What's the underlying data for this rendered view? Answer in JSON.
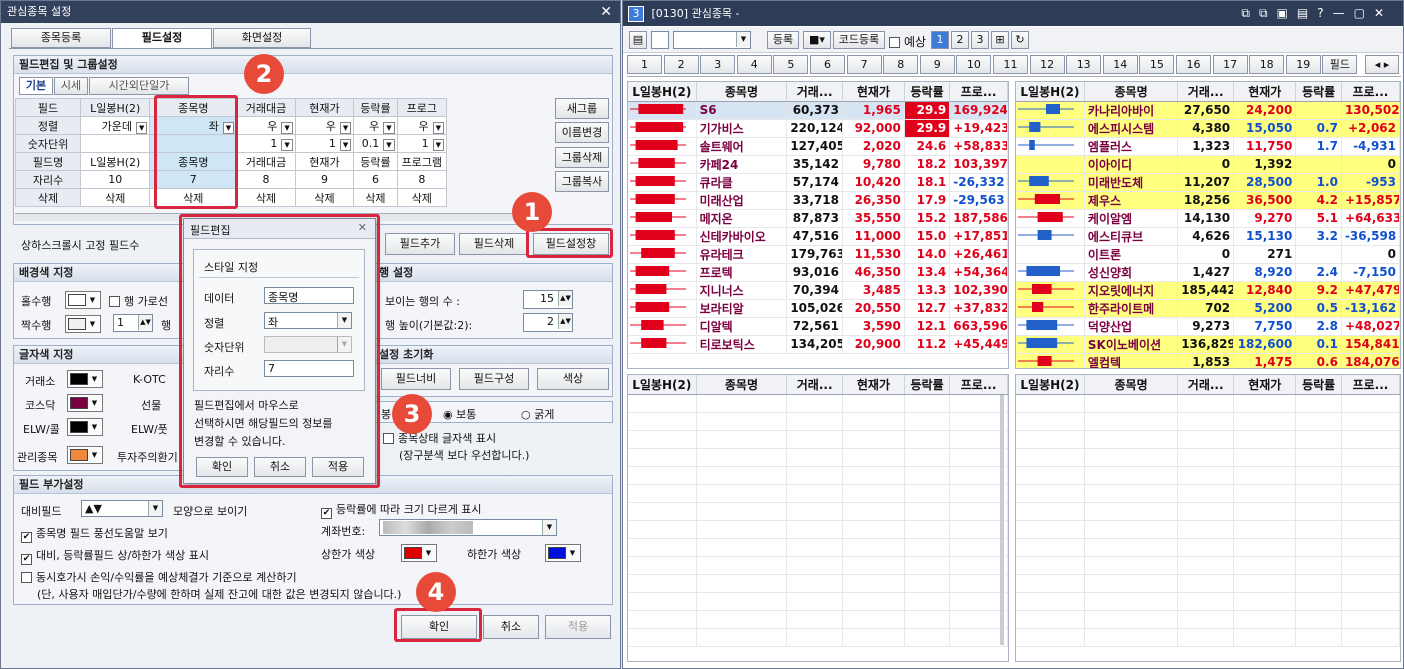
{
  "left_window": {
    "title": "관심종목 설정",
    "tabs": [
      "종목등록",
      "필드설정",
      "화면설정"
    ],
    "section_title": "필드편집 및 그룹설정",
    "subtabs": [
      "기본",
      "시세",
      "시간외단일가"
    ],
    "field_rows": {
      "labels": [
        "필드",
        "정렬",
        "숫자단위",
        "필드명",
        "자리수",
        "삭제"
      ],
      "cols": [
        {
          "field": "L일봉H(2)",
          "align": "가운데",
          "unit": "",
          "name": "L일봉H(2)",
          "digits": "10",
          "del": "삭제"
        },
        {
          "field": "종목명",
          "align": "좌",
          "unit": "",
          "name": "종목명",
          "digits": "7",
          "del": "삭제"
        },
        {
          "field": "거래대금",
          "align": "우",
          "unit": "1",
          "name": "거래대금",
          "digits": "8",
          "del": "삭제"
        },
        {
          "field": "현재가",
          "align": "우",
          "unit": "1",
          "name": "현재가",
          "digits": "9",
          "del": "삭제"
        },
        {
          "field": "등락률",
          "align": "우",
          "unit": "0.1",
          "name": "등락률",
          "digits": "6",
          "del": "삭제"
        },
        {
          "field": "프로그",
          "align": "우",
          "unit": "1",
          "name": "프로그램",
          "digits": "8",
          "del": "삭제"
        }
      ]
    },
    "side_buttons": [
      "새그룹",
      "이름변경",
      "그룹삭제",
      "그룹복사"
    ],
    "fixed_label": "상하스크롤시 고정 필드수",
    "field_buttons": [
      "필드추가",
      "필드삭제",
      "필드설정창"
    ],
    "bg_section": {
      "title": "배경색 지정",
      "odd": "홀수행",
      "even": "짝수행",
      "row_line": "행 가로선",
      "row_label": "행",
      "stepper": "1"
    },
    "row_section": {
      "title": "행 설정",
      "visible_rows": "보이는 행의 수 :",
      "visible_val": "15",
      "row_height": "행 높이(기본값:2):",
      "height_val": "2"
    },
    "font_section": {
      "title": "글자색 지정",
      "items": [
        "거래소",
        "코스닥",
        "ELW/콜",
        "관리종목"
      ],
      "items2": [
        "K-OTC",
        "선물",
        "ELW/풋",
        "투자주의환기"
      ]
    },
    "init_section": {
      "title": "설정 초기화",
      "buttons": [
        "필드너비",
        "필드구성",
        "색상"
      ]
    },
    "font_style": {
      "title": "봉",
      "normal": "보통",
      "bold": "굵게"
    },
    "status_color": {
      "label": "종목상태 글자색 표시",
      "note": "(장구분색 보다 우선합니다.)"
    },
    "extra_section": {
      "title": "필드 부가설정",
      "contrast_label": "대비필드",
      "contrast_value": "▲▼",
      "shape_label": "모양으로 보이기",
      "size_label": "등락률에 따라 크기 다르게 표시",
      "tooltip_label": "종목명 필드 풍선도움말 보기",
      "account_label": "계좌번호:",
      "limit_label": "대비, 등락률필드 상/하한가 색상 표시",
      "upper_label": "상한가 색상",
      "lower_label": "하한가 색상",
      "simul_label": "동시호가시 손익/수익률을 예상체결가 기준으로 계산하기",
      "simul_note": "(단, 사용자 매입단가/수량에 한하며 실제 잔고에 대한 값은 변경되지 않습니다.)"
    },
    "bottom_buttons": [
      "확인",
      "취소",
      "적용"
    ]
  },
  "popup": {
    "title": "필드편집",
    "group": "스타일 지정",
    "data_label": "데이터",
    "data_value": "종목명",
    "align_label": "정렬",
    "align_value": "좌",
    "unit_label": "숫자단위",
    "digits_label": "자리수",
    "digits_value": "7",
    "help": [
      "필드편집에서 마우스로",
      "선택하시면 해당필드의 정보를",
      "변경할 수 있습니다."
    ],
    "buttons": [
      "확인",
      "취소",
      "적용"
    ]
  },
  "badges": [
    "1",
    "2",
    "3",
    "4"
  ],
  "right_window": {
    "title": "[0130] 관심종목 -",
    "num_icon": "3",
    "toolbar": {
      "register": "등록",
      "code_register": "코드등록",
      "expect": "예상",
      "pages": [
        "1",
        "2",
        "3"
      ]
    },
    "tabs": [
      "1",
      "2",
      "3",
      "4",
      "5",
      "6",
      "7",
      "8",
      "9",
      "10",
      "11",
      "12",
      "13",
      "14",
      "15",
      "16",
      "17",
      "18",
      "19",
      "필드"
    ],
    "headers": [
      "L일봉H(2)",
      "종목명",
      "거래...",
      "현재가",
      "등락률",
      "프로..."
    ],
    "left_rows": [
      {
        "name": "S6",
        "vol": "60,373",
        "price": "1,965",
        "rate": "29.9",
        "prog": "169,924",
        "hl": true,
        "sel": true,
        "candle": "r:0.15:0.95"
      },
      {
        "name": "기가비스",
        "vol": "220,124",
        "price": "92,000",
        "rate": "29.9",
        "prog": "+19,423",
        "hl": true,
        "candle": "r:0.1:0.95"
      },
      {
        "name": "솔트웨어",
        "vol": "127,405",
        "price": "2,020",
        "rate": "24.6",
        "prog": "+58,833",
        "candle": "r:0.1:0.85"
      },
      {
        "name": "카페24",
        "vol": "35,142",
        "price": "9,780",
        "rate": "18.2",
        "prog": "103,397",
        "candle": "r:0.15:0.8"
      },
      {
        "name": "큐라클",
        "vol": "57,174",
        "price": "10,420",
        "rate": "18.1",
        "prog": "-26,332",
        "candle": "r:0.1:0.8"
      },
      {
        "name": "미래산업",
        "vol": "33,718",
        "price": "26,350",
        "rate": "17.9",
        "prog": "-29,563",
        "candle": "r:0.1:0.8"
      },
      {
        "name": "메지온",
        "vol": "87,873",
        "price": "35,550",
        "rate": "15.2",
        "prog": "187,586",
        "candle": "r:0.1:0.75"
      },
      {
        "name": "신테카바이오",
        "vol": "47,516",
        "price": "11,000",
        "rate": "15.0",
        "prog": "+17,851",
        "candle": "r:0.1:0.8"
      },
      {
        "name": "유라테크",
        "vol": "179,763",
        "price": "11,530",
        "rate": "14.0",
        "prog": "+26,461",
        "candle": "r:0.2:0.8"
      },
      {
        "name": "프로텍",
        "vol": "93,016",
        "price": "46,350",
        "rate": "13.4",
        "prog": "+54,364",
        "candle": "r:0.1:0.7"
      },
      {
        "name": "지니너스",
        "vol": "70,394",
        "price": "3,485",
        "rate": "13.3",
        "prog": "102,390",
        "candle": "r:0.1:0.65"
      },
      {
        "name": "보라티알",
        "vol": "105,026",
        "price": "20,550",
        "rate": "12.7",
        "prog": "+37,832",
        "candle": "r:0.1:0.7"
      },
      {
        "name": "디알텍",
        "vol": "72,561",
        "price": "3,590",
        "rate": "12.1",
        "prog": "663,596",
        "candle": "r:0.2:0.6"
      },
      {
        "name": "티로보틱스",
        "vol": "134,205",
        "price": "20,900",
        "rate": "11.2",
        "prog": "+45,449",
        "candle": "r:0.2:0.65"
      }
    ],
    "right_rows": [
      {
        "name": "카나리아바이",
        "vol": "27,650",
        "price": "24,200",
        "rate": "",
        "prog": "130,502",
        "hl": true,
        "candle": "b:0.5:0.75",
        "pc": "up",
        "rc": ""
      },
      {
        "name": "에스피시스템",
        "vol": "4,380",
        "price": "15,050",
        "rate": "0.7",
        "prog": "+2,062",
        "hl": true,
        "candle": "b:0.2:0.4",
        "pc": "dn",
        "rc": "dn"
      },
      {
        "name": "엠플러스",
        "vol": "1,323",
        "price": "11,750",
        "rate": "1.7",
        "prog": "-4,931",
        "candle": "b:0.2:0.3",
        "pc": "up",
        "rc": "dn"
      },
      {
        "name": "이아이디",
        "vol": "0",
        "price": "1,392",
        "rate": "",
        "prog": "0",
        "hl": true,
        "candle": "",
        "pc": "",
        "rc": ""
      },
      {
        "name": "미래반도체",
        "vol": "11,207",
        "price": "28,500",
        "rate": "1.0",
        "prog": "-953",
        "hl": true,
        "candle": "b:0.2:0.55",
        "pc": "dn",
        "rc": "dn"
      },
      {
        "name": "제우스",
        "vol": "18,256",
        "price": "36,500",
        "rate": "4.2",
        "prog": "+15,857",
        "hl": true,
        "candle": "r:0.3:0.75",
        "pc": "up",
        "rc": "up"
      },
      {
        "name": "케이알엠",
        "vol": "14,130",
        "price": "9,270",
        "rate": "5.1",
        "prog": "+64,633",
        "candle": "r:0.35:0.8",
        "pc": "up",
        "rc": "up"
      },
      {
        "name": "에스티큐브",
        "vol": "4,626",
        "price": "15,130",
        "rate": "3.2",
        "prog": "-36,598",
        "candle": "b:0.35:0.6",
        "pc": "dn",
        "rc": "dn"
      },
      {
        "name": "이트론",
        "vol": "0",
        "price": "271",
        "rate": "",
        "prog": "0",
        "candle": "",
        "pc": "",
        "rc": ""
      },
      {
        "name": "성신양회",
        "vol": "1,427",
        "price": "8,920",
        "rate": "2.4",
        "prog": "-7,150",
        "candle": "b:0.15:0.75",
        "pc": "dn",
        "rc": "dn"
      },
      {
        "name": "지오릿에너지",
        "vol": "185,442",
        "price": "12,840",
        "rate": "9.2",
        "prog": "+47,479",
        "hl": true,
        "candle": "r:0.25:0.6",
        "pc": "up",
        "rc": "up"
      },
      {
        "name": "한주라이트메",
        "vol": "702",
        "price": "5,200",
        "rate": "0.5",
        "prog": "-13,162",
        "hl": true,
        "candle": "r:0.25:0.45",
        "pc": "dn",
        "rc": "dn"
      },
      {
        "name": "덕양산업",
        "vol": "9,273",
        "price": "7,750",
        "rate": "2.8",
        "prog": "+48,027",
        "candle": "b:0.15:0.7",
        "pc": "dn",
        "rc": "dn"
      },
      {
        "name": "SK이노베이션",
        "vol": "136,829",
        "price": "182,600",
        "rate": "0.1",
        "prog": "154,841",
        "hl": true,
        "candle": "b:0.15:0.7",
        "pc": "dn",
        "rc": "dn"
      },
      {
        "name": "엘컴텍",
        "vol": "1,853",
        "price": "1,475",
        "rate": "0.6",
        "prog": "184,076",
        "hl": true,
        "candle": "r:0.35:0.6",
        "pc": "up",
        "rc": "up"
      }
    ]
  },
  "colors": {
    "accent": "#d7263d",
    "badge": "#e84a3a",
    "title_bar": "#2f3c58",
    "highlight_yellow": "#ffff80",
    "up": "#e0001b",
    "down": "#1050d0"
  }
}
